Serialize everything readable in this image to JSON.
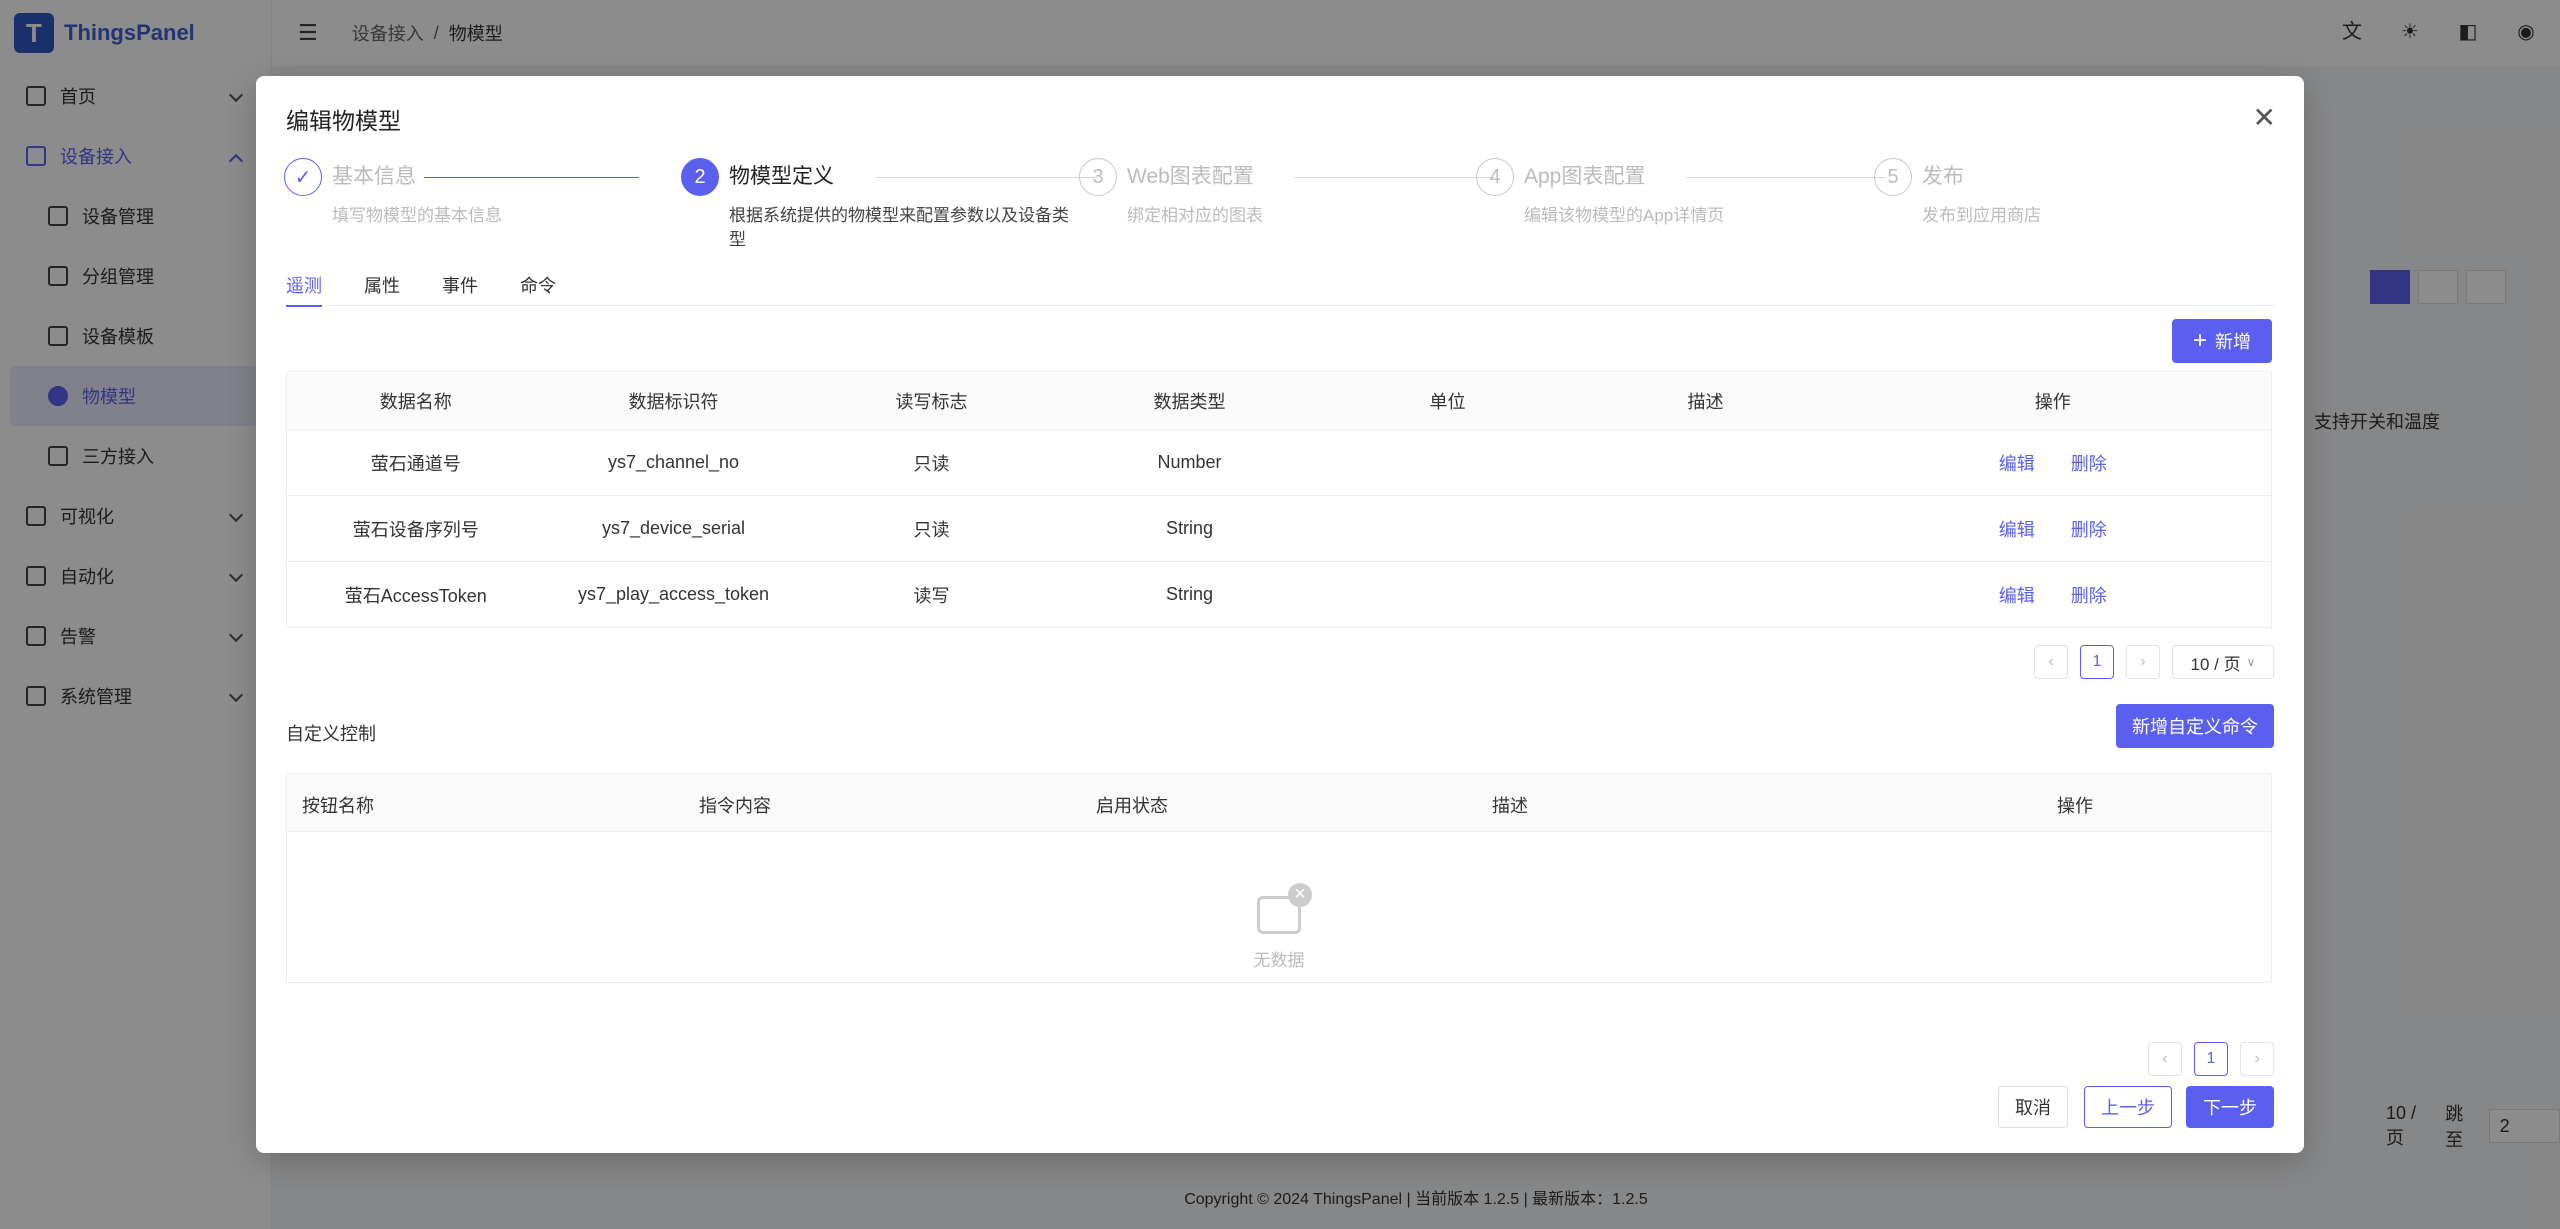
{
  "app": {
    "name": "ThingsPanel",
    "logo_letter": "T"
  },
  "sidebar": {
    "items": [
      {
        "label": "首页"
      },
      {
        "label": "设备接入"
      },
      {
        "label": "设备管理"
      },
      {
        "label": "分组管理"
      },
      {
        "label": "设备模板"
      },
      {
        "label": "物模型"
      },
      {
        "label": "三方接入"
      },
      {
        "label": "可视化"
      },
      {
        "label": "自动化"
      },
      {
        "label": "告警"
      },
      {
        "label": "系统管理"
      }
    ]
  },
  "breadcrumb": {
    "parent": "设备接入",
    "sep": "/",
    "current": "物模型"
  },
  "background": {
    "card_text": "支持开关和温度",
    "page_size": "10 / 页",
    "jump_label": "跳至",
    "jump_value": "2"
  },
  "footer": {
    "text": "Copyright © 2024 ThingsPanel  |  当前版本 1.2.5  |  最新版本：1.2.5"
  },
  "modal": {
    "title": "编辑物模型",
    "close_glyph": "✕",
    "steps": [
      {
        "num": "✓",
        "title": "基本信息",
        "desc": "填写物模型的基本信息",
        "status": "done"
      },
      {
        "num": "2",
        "title": "物模型定义",
        "desc": "根据系统提供的物模型来配置参数以及设备类型",
        "status": "current"
      },
      {
        "num": "3",
        "title": "Web图表配置",
        "desc": "绑定相对应的图表",
        "status": "wait"
      },
      {
        "num": "4",
        "title": "App图表配置",
        "desc": "编辑该物模型的App详情页",
        "status": "wait"
      },
      {
        "num": "5",
        "title": "发布",
        "desc": "发布到应用商店",
        "status": "wait"
      }
    ],
    "tabs": [
      "遥测",
      "属性",
      "事件",
      "命令"
    ],
    "active_tab": 0,
    "add_button": "新增",
    "telemetry": {
      "headers": [
        "数据名称",
        "数据标识符",
        "读写标志",
        "数据类型",
        "单位",
        "描述",
        "操作"
      ],
      "rows": [
        {
          "name": "萤石通道号",
          "key": "ys7_channel_no",
          "rw": "只读",
          "type": "Number",
          "unit": "",
          "desc": ""
        },
        {
          "name": "萤石设备序列号",
          "key": "ys7_device_serial",
          "rw": "只读",
          "type": "String",
          "unit": "",
          "desc": ""
        },
        {
          "name": "萤石AccessToken",
          "key": "ys7_play_access_token",
          "rw": "读写",
          "type": "String",
          "unit": "",
          "desc": ""
        }
      ],
      "edit_label": "编辑",
      "delete_label": "删除"
    },
    "pager": {
      "prev": "‹",
      "page": "1",
      "next": "›",
      "size": "10 / 页"
    },
    "custom": {
      "title": "自定义控制",
      "add_button": "新增自定义命令",
      "headers": [
        "按钮名称",
        "指令内容",
        "启用状态",
        "描述",
        "操作"
      ],
      "empty_text": "无数据"
    },
    "pager2": {
      "prev": "‹",
      "page": "1",
      "next": "›"
    },
    "buttons": {
      "cancel": "取消",
      "prev": "上一步",
      "next": "下一步"
    }
  },
  "colors": {
    "accent": "#5b5ff0",
    "brand": "#2f58c4"
  }
}
